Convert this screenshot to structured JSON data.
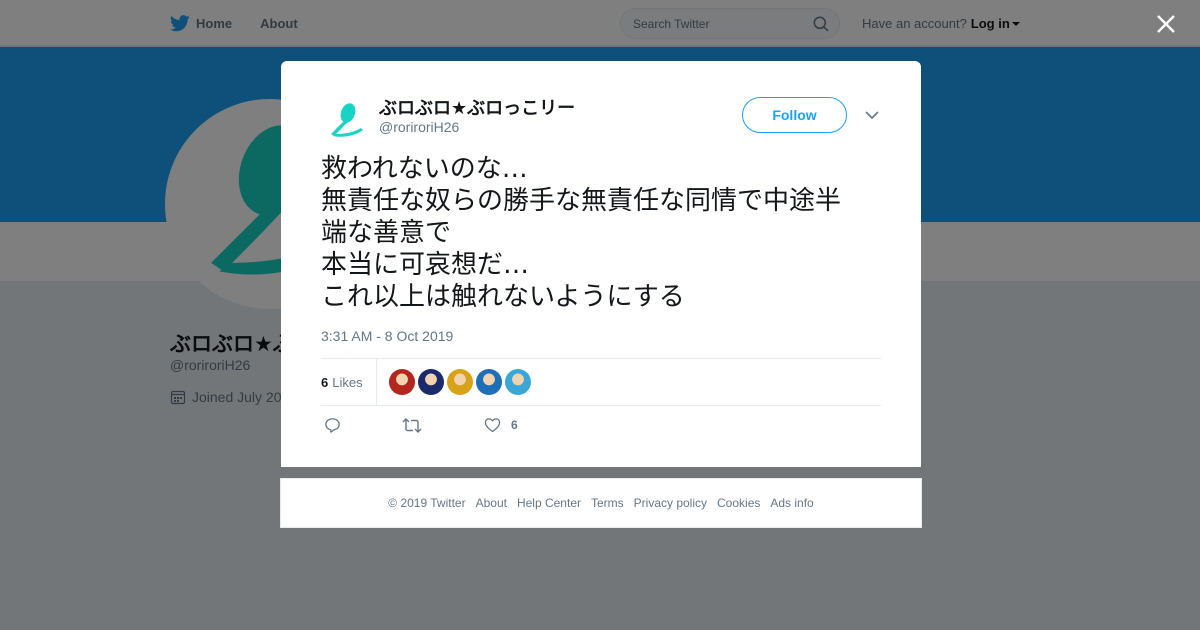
{
  "nav": {
    "home_label": "Home",
    "about_label": "About",
    "search_placeholder": "Search Twitter",
    "account_prompt": "Have an account?",
    "login_label": "Log in"
  },
  "profile_bg": {
    "name": "ぶロぶロ★ぶ",
    "handle": "@roriroriH26",
    "joined": "Joined July 20"
  },
  "tweet": {
    "display_name": "ぶロぶロ★ぶロっこリー",
    "handle": "@roriroriH26",
    "follow_label": "Follow",
    "text_lines": [
      "救われないのな…",
      "無責任な奴らの勝手な無責任な同情で中途半",
      "端な善意で",
      "本当に可哀想だ…",
      "これ以上は触れないようにする"
    ],
    "timestamp": "3:31 AM - 8 Oct 2019",
    "likes_count": "6",
    "likes_label": "Likes",
    "like_action_count": "6",
    "liker_colors": [
      "#b3261e",
      "#1b2a6b",
      "#d9a21b",
      "#1e6fb8",
      "#3aa7d9"
    ]
  },
  "footer": {
    "links": [
      "© 2019 Twitter",
      "About",
      "Help Center",
      "Terms",
      "Privacy policy",
      "Cookies",
      "Ads info"
    ]
  },
  "colors": {
    "brand": "#1da1f2",
    "avatar_accent": "#19d3c5"
  },
  "icons": [
    "twitter-bird-icon",
    "search-icon",
    "close-icon",
    "chevron-down-icon",
    "calendar-icon",
    "reply-icon",
    "retweet-icon",
    "heart-icon"
  ]
}
